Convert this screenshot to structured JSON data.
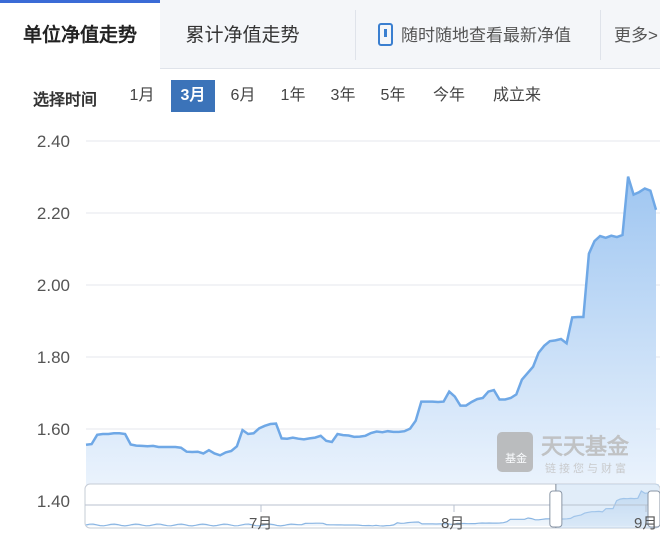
{
  "tabs": [
    {
      "label": "单位净值走势",
      "active": true
    },
    {
      "label": "累计净值走势",
      "active": false
    }
  ],
  "mobile_tab": {
    "label": "随时随地查看最新净值",
    "icon": "mobile-phone-icon"
  },
  "more_tab": {
    "label": "更多>"
  },
  "range": {
    "label": "选择时间",
    "options": [
      "1月",
      "3月",
      "6月",
      "1年",
      "3年",
      "5年",
      "今年",
      "成立来"
    ],
    "selected": "3月"
  },
  "watermark": {
    "title": "天天基金",
    "subtitle": "链接您与财富",
    "logo_text": "基金"
  },
  "colors": {
    "accent": "#3b73b9",
    "line": "#6fa8e6",
    "area_top": "#a9cdf3",
    "area_bottom": "#e9f2fc"
  },
  "chart_data": {
    "type": "area",
    "yticks": [
      "2.40",
      "2.20",
      "2.00",
      "1.80",
      "1.60",
      "1.40"
    ],
    "ylim": [
      1.4,
      2.4
    ],
    "grid": true,
    "values": [
      1.556,
      1.558,
      1.584,
      1.586,
      1.586,
      1.588,
      1.588,
      1.586,
      1.557,
      1.554,
      1.553,
      1.552,
      1.553,
      1.55,
      1.55,
      1.55,
      1.55,
      1.548,
      1.537,
      1.536,
      1.537,
      1.532,
      1.541,
      1.532,
      1.527,
      1.535,
      1.539,
      1.552,
      1.597,
      1.586,
      1.588,
      1.602,
      1.609,
      1.614,
      1.615,
      1.574,
      1.573,
      1.576,
      1.573,
      1.571,
      1.574,
      1.576,
      1.581,
      1.567,
      1.564,
      1.586,
      1.583,
      1.582,
      1.578,
      1.579,
      1.581,
      1.589,
      1.593,
      1.591,
      1.594,
      1.592,
      1.592,
      1.594,
      1.601,
      1.623,
      1.676,
      1.676,
      1.676,
      1.675,
      1.676,
      1.704,
      1.69,
      1.665,
      1.665,
      1.675,
      1.683,
      1.686,
      1.704,
      1.708,
      1.682,
      1.682,
      1.686,
      1.696,
      1.737,
      1.755,
      1.773,
      1.812,
      1.831,
      1.844,
      1.846,
      1.85,
      1.838,
      1.91,
      1.911,
      1.911,
      2.087,
      2.122,
      2.136,
      2.131,
      2.137,
      2.133,
      2.139,
      2.301,
      2.251,
      2.258,
      2.268,
      2.262,
      2.209
    ],
    "navigator": {
      "labels": [
        "7月",
        "8月",
        "9月"
      ],
      "handle_left": 0.82,
      "handle_right": 1.0
    }
  }
}
